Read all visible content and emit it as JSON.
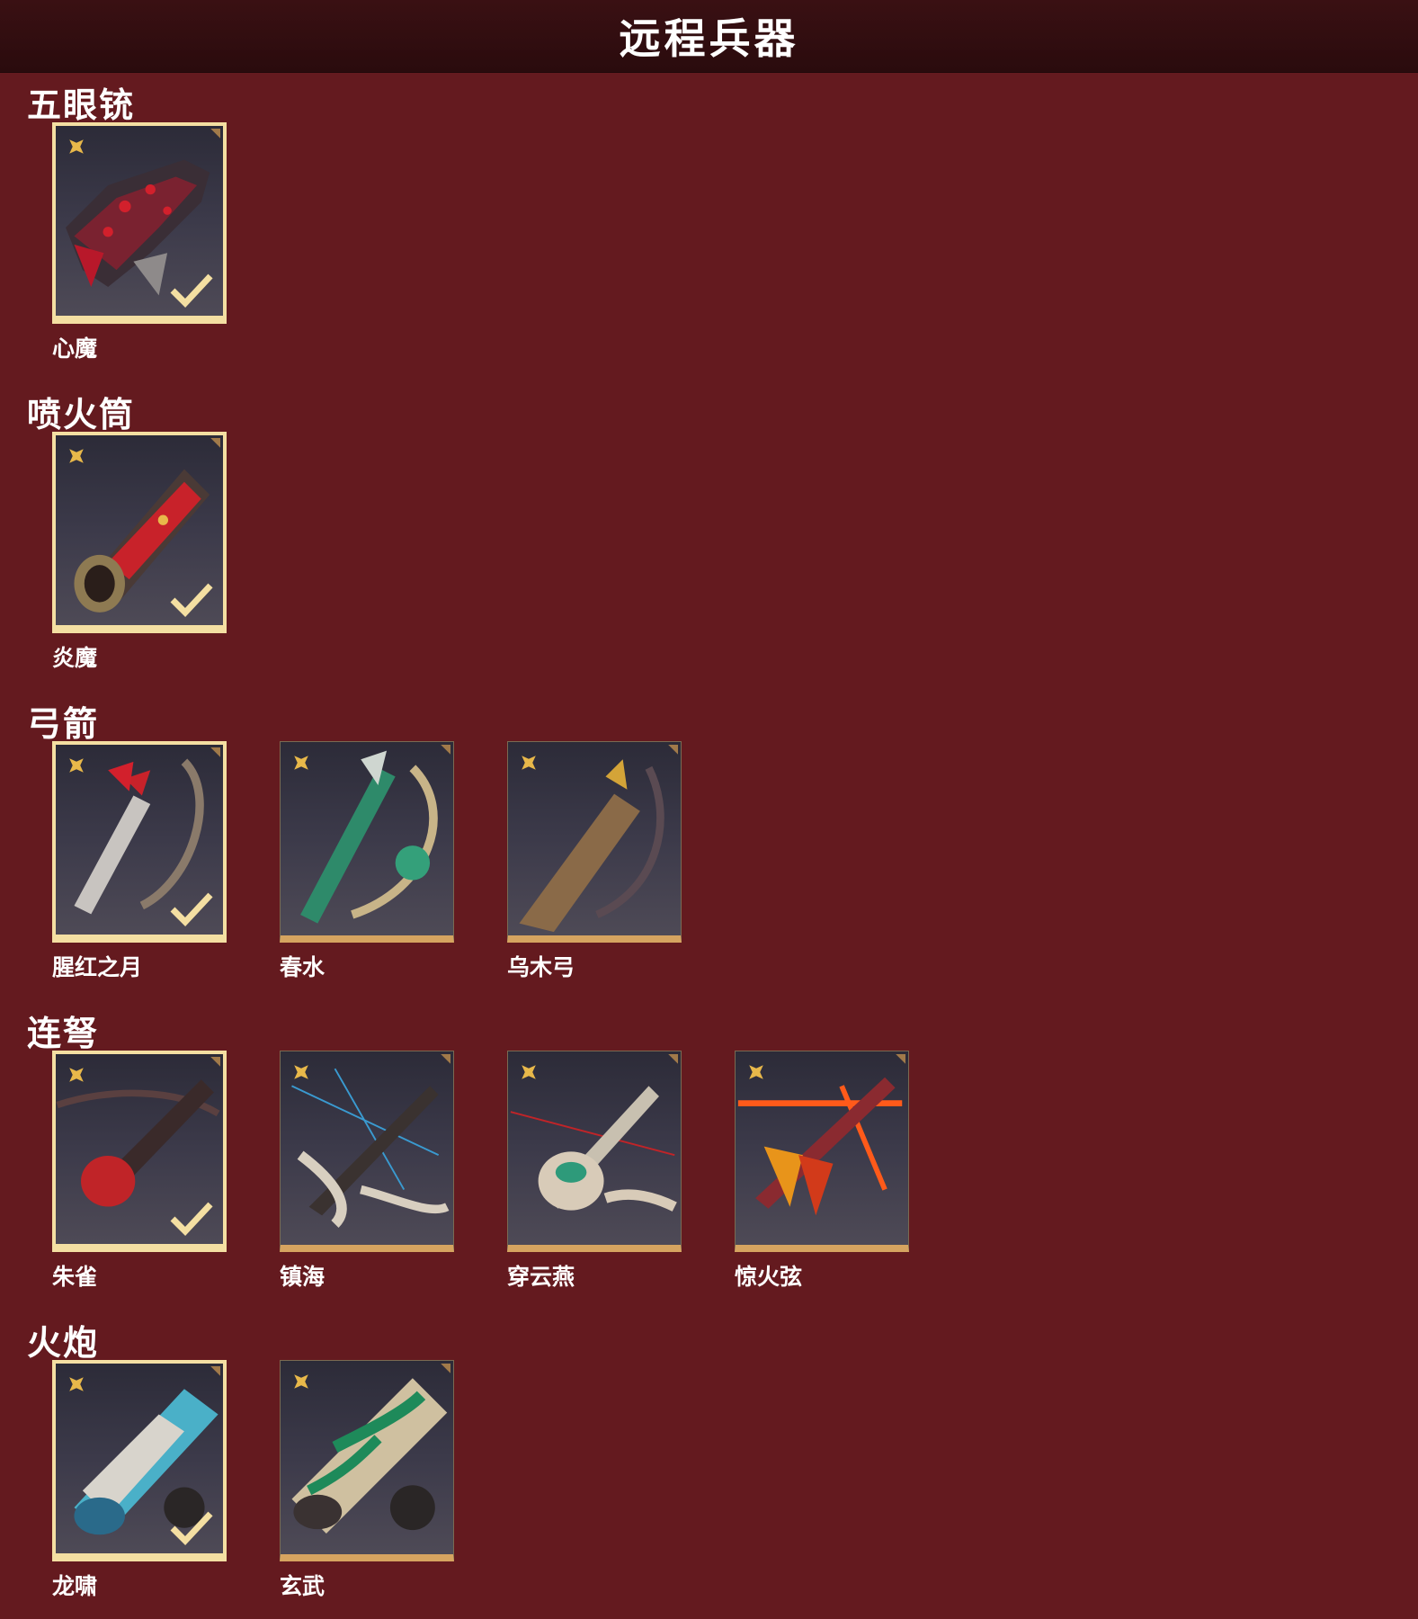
{
  "page_title": "远程兵器",
  "colors": {
    "background": "#641a1f",
    "header": "#2a0b0d",
    "equipped_border": "#f4dfa2",
    "card_bottom": "#d6a460",
    "rarity_icon": "#e8b84a"
  },
  "categories": [
    {
      "title": "五眼铳",
      "items": [
        {
          "name": "心魔",
          "equipped": true,
          "icon": "demon-gun-icon"
        }
      ]
    },
    {
      "title": "喷火筒",
      "items": [
        {
          "name": "炎魔",
          "equipped": true,
          "icon": "flame-tube-icon"
        }
      ]
    },
    {
      "title": "弓箭",
      "items": [
        {
          "name": "腥红之月",
          "equipped": true,
          "icon": "crimson-bow-icon"
        },
        {
          "name": "春水",
          "equipped": false,
          "icon": "jade-bow-icon"
        },
        {
          "name": "乌木弓",
          "equipped": false,
          "icon": "wood-bow-icon"
        }
      ]
    },
    {
      "title": "连弩",
      "items": [
        {
          "name": "朱雀",
          "equipped": true,
          "icon": "red-crossbow-icon"
        },
        {
          "name": "镇海",
          "equipped": false,
          "icon": "sea-crossbow-icon"
        },
        {
          "name": "穿云燕",
          "equipped": false,
          "icon": "swallow-crossbow-icon"
        },
        {
          "name": "惊火弦",
          "equipped": false,
          "icon": "fire-crossbow-icon"
        }
      ]
    },
    {
      "title": "火炮",
      "items": [
        {
          "name": "龙啸",
          "equipped": true,
          "icon": "dragon-cannon-icon"
        },
        {
          "name": "玄武",
          "equipped": false,
          "icon": "tortoise-cannon-icon"
        }
      ]
    }
  ]
}
